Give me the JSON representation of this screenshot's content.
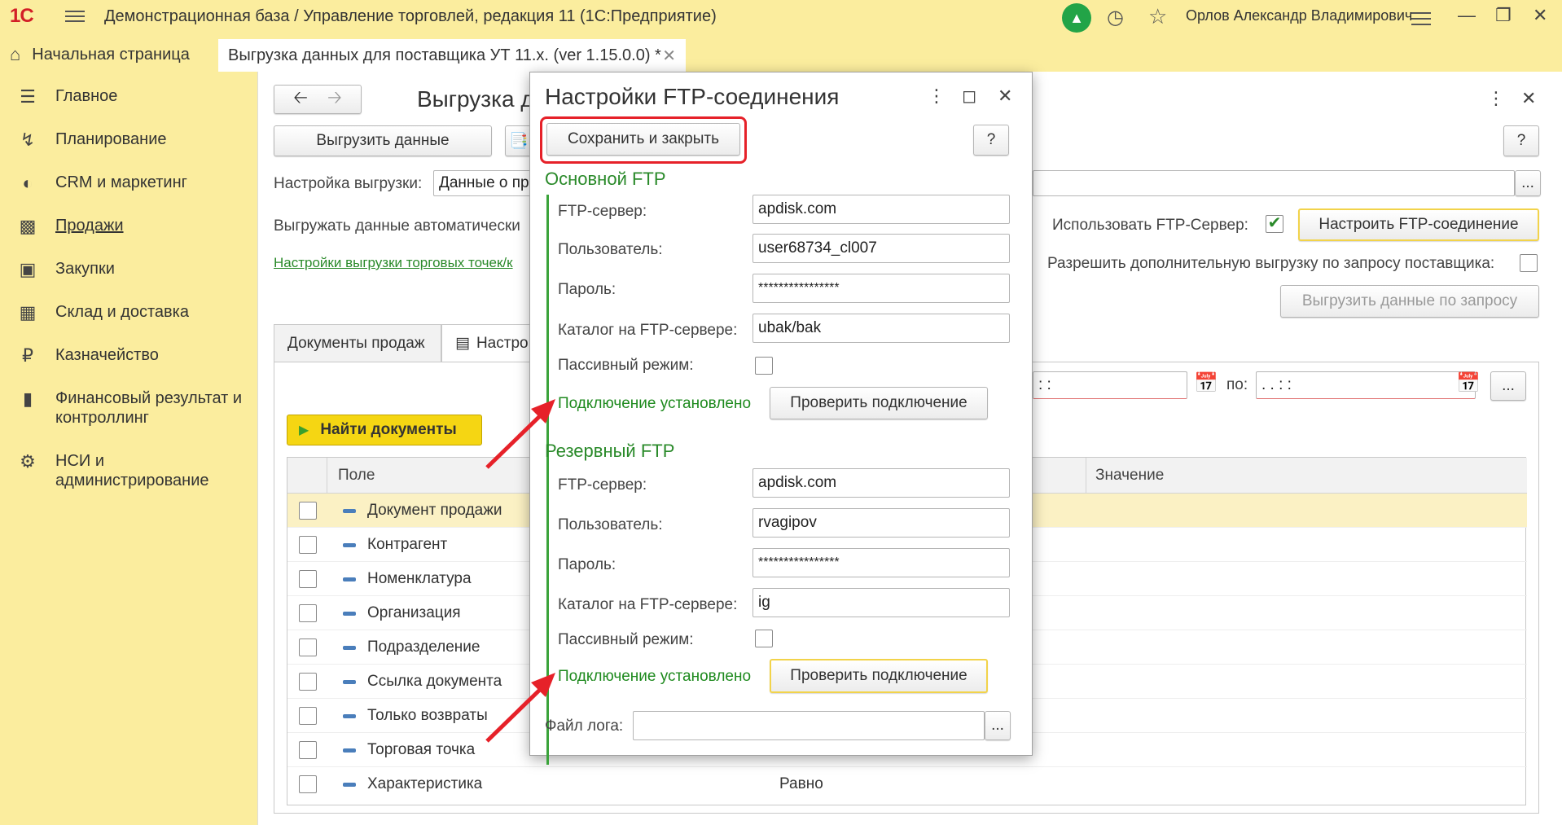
{
  "topbar": {
    "logo": "1С",
    "app_title": "Демонстрационная база / Управление торговлей, редакция 11  (1С:Предприятие)",
    "user_name": "Орлов Александр Владимирович",
    "icons": [
      "bell-icon",
      "history-icon",
      "star-icon",
      "menu-lines-icon",
      "minimize-icon",
      "restore-icon",
      "close-icon"
    ]
  },
  "tabs": {
    "home": "Начальная страница",
    "current": "Выгрузка данных для поставщика УТ 11.х. (ver 1.15.0.0) *"
  },
  "sidebar": {
    "items": [
      {
        "label": "Главное",
        "icon": "menu-icon"
      },
      {
        "label": "Планирование",
        "icon": "planning-icon"
      },
      {
        "label": "CRM и маркетинг",
        "icon": "crm-icon"
      },
      {
        "label": "Продажи",
        "icon": "bag-icon"
      },
      {
        "label": "Закупки",
        "icon": "cart-icon"
      },
      {
        "label": "Склад и доставка",
        "icon": "warehouse-icon"
      },
      {
        "label": "Казначейство",
        "icon": "ruble-icon"
      },
      {
        "label": "Финансовый результат и контроллинг",
        "icon": "chart-icon"
      },
      {
        "label": "НСИ и администрирование",
        "icon": "gear-icon"
      }
    ]
  },
  "main": {
    "title": "Выгрузка д",
    "export_button": "Выгрузить данные",
    "settings_label": "Настройка выгрузки:",
    "settings_value": "Данные о пр",
    "auto_label": "Выгружать данные автоматически",
    "outlets_link": "Настройки выгрузки торговых точек/к",
    "use_ftp_label": "Использовать FTP-Сервер:",
    "configure_ftp_button": "Настроить FTP-соединение",
    "allow_extra_label": "Разрешить дополнительную выгрузку по запросу поставщика:",
    "export_on_request_button": "Выгрузить данные по запросу",
    "help": "?",
    "more_button": "...",
    "period_to_label": "по:",
    "date_from_placeholder": "  :  :",
    "date_to_placeholder": " .  .      :  :",
    "subtabs": [
      "Документы продаж",
      "Настро"
    ],
    "find_button": "Найти документы",
    "table": {
      "columns": [
        "Поле",
        "Значение"
      ],
      "rows": [
        {
          "name": "Документ продажи",
          "value": ""
        },
        {
          "name": "Контрагент",
          "value": ""
        },
        {
          "name": "Номенклатура",
          "value": ""
        },
        {
          "name": "Организация",
          "value": ""
        },
        {
          "name": "Подразделение",
          "value": ""
        },
        {
          "name": "Ссылка документа",
          "value": ""
        },
        {
          "name": "Только возвраты",
          "value": ""
        },
        {
          "name": "Торговая точка",
          "value": ""
        },
        {
          "name": "Характеристика",
          "value": "Равно"
        }
      ]
    }
  },
  "dialog": {
    "title": "Настройки FTP-соединения",
    "save_close": "Сохранить и закрыть",
    "help": "?",
    "primary": {
      "title": "Основной FTP",
      "server_label": "FTP-сервер:",
      "server": "apdisk.com",
      "user_label": "Пользователь:",
      "user": "user68734_cl007",
      "password_label": "Пароль:",
      "password": "****************",
      "catalog_label": "Каталог на FTP-сервере:",
      "catalog": "ubak/bak",
      "passive_label": "Пассивный режим:",
      "status": "Подключение установлено",
      "check_button": "Проверить подключение"
    },
    "reserve": {
      "title": "Резервный FTP",
      "server_label": "FTP-сервер:",
      "server": "apdisk.com",
      "user_label": "Пользователь:",
      "user": "rvagipov",
      "password_label": "Пароль:",
      "password": "****************",
      "catalog_label": "Каталог на FTP-сервере:",
      "catalog": "ig",
      "passive_label": "Пассивный режим:",
      "status": "Подключение установлено",
      "check_button": "Проверить подключение"
    },
    "log_label": "Файл лога:",
    "log_value": "",
    "log_button": "..."
  },
  "colors": {
    "panel_yellow": "#fbed9e",
    "accent_green": "#2a8a2a",
    "highlight_red": "#e62129",
    "find_button_yellow": "#f5d613"
  }
}
